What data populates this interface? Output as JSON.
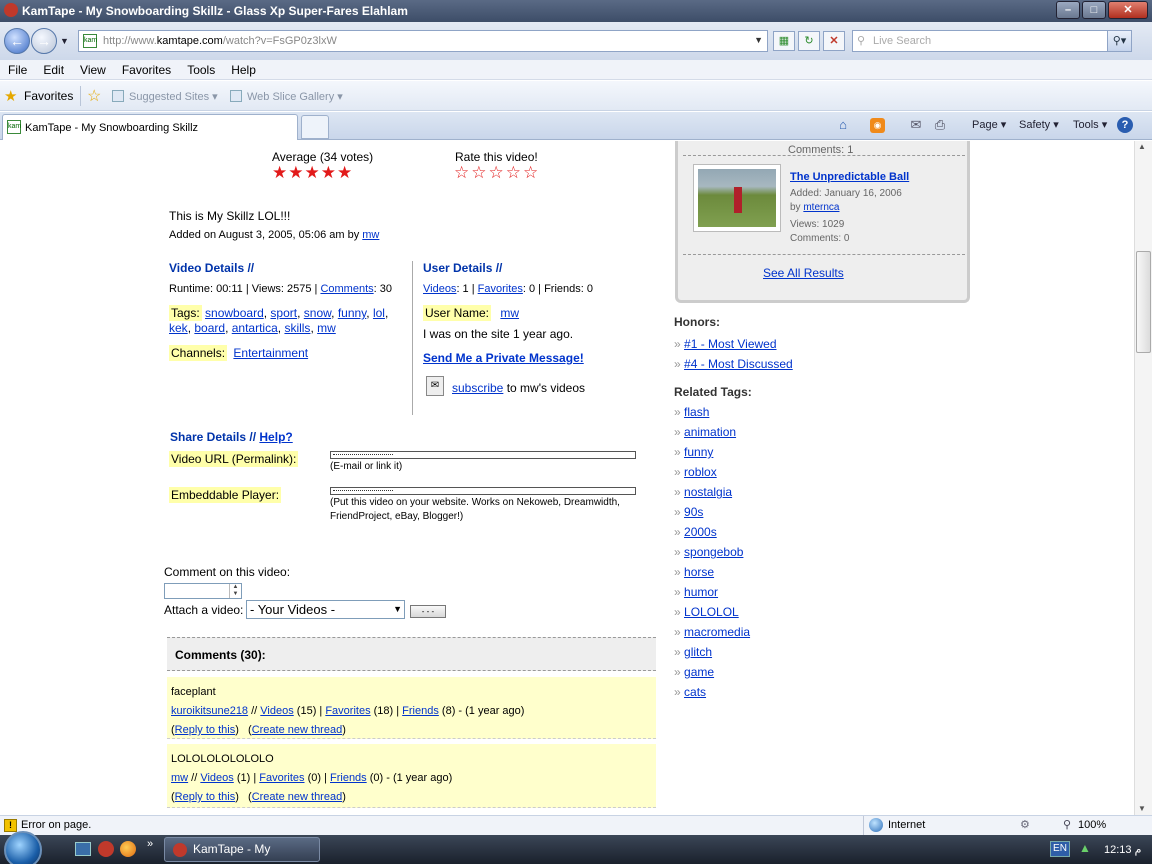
{
  "window": {
    "title": "KamTape - My Snowboarding Skillz - Glass Xp Super-Fares Elahlam",
    "buttons": {
      "minimize": "–",
      "maximize": "□",
      "close": "✕"
    }
  },
  "address_bar": {
    "url_prefix": "http://www.",
    "url_domain": "kamtape.com",
    "url_suffix": "/watch?v=FsGP0z3lxW",
    "favicon_text": "kam",
    "search_placeholder": "Live Search"
  },
  "menu": [
    "File",
    "Edit",
    "View",
    "Favorites",
    "Tools",
    "Help"
  ],
  "favorites_bar": {
    "favorites_label": "Favorites",
    "suggested_sites": "Suggested Sites ▾",
    "web_slice_gallery": "Web Slice Gallery ▾"
  },
  "tab": {
    "title": "KamTape - My Snowboarding Skillz"
  },
  "command_bar": {
    "page": "Page ▾",
    "safety": "Safety ▾",
    "tools": "Tools ▾"
  },
  "rating": {
    "average_label": "Average (34 votes)",
    "average_stars": "★★★★★",
    "average_value": 4.5,
    "rate_label": "Rate this video!",
    "rate_stars": "☆☆☆☆☆"
  },
  "video": {
    "description": "This is My Skillz LOL!!!",
    "added_prefix": "Added on August 3, 2005, 05:06 am by ",
    "added_user": "mw"
  },
  "video_details": {
    "title": "Video Details",
    "sep": " //",
    "runtime_views": "Runtime: 00:11 | Views: 2575 | ",
    "comments_link": "Comments",
    "comments_count": ": 30",
    "tags_label": "Tags:",
    "tags": [
      "snowboard",
      "sport",
      "snow",
      "funny",
      "lol",
      "kek",
      "board",
      "antartica",
      "skills",
      "mw"
    ],
    "channels_label": "Channels:",
    "channel": "Entertainment"
  },
  "user_details": {
    "title": "User Details",
    "sep": " //",
    "videos_link": "Videos",
    "videos_count": ": 1 | ",
    "favorites_link": "Favorites",
    "favorites_count": ": 0 | Friends: 0",
    "username_label": "User Name:",
    "username": "mw",
    "joined": "I was on the site 1 year ago.",
    "private_message": "Send Me a Private Message!",
    "subscribe_link": "subscribe",
    "subscribe_suffix": " to mw's videos"
  },
  "share": {
    "title": "Share Details",
    "sep": " // ",
    "help": "Help?",
    "url_label": "Video URL (Permalink):",
    "url_hint": "(E-mail or link it)",
    "embed_label": "Embeddable Player:",
    "embed_hint_1": "(Put this video on your website. Works on Nekoweb, Dreamwidth,",
    "embed_hint_2": "FriendProject, eBay, Blogger!)"
  },
  "comment_form": {
    "title": "Comment on this video:",
    "attach_label": "Attach a video:",
    "select_value": "- Your Videos -",
    "button_label": "- - -"
  },
  "comments": {
    "header": "Comments (30):",
    "items": [
      {
        "text": "faceplant",
        "user": "kuroikitsune218",
        "videos": "Videos",
        "videos_count": " (15) | ",
        "favorites": "Favorites",
        "favorites_count": " (18) | ",
        "friends": "Friends",
        "friends_count": " (8) - (1 year ago)",
        "reply": "Reply to this",
        "new_thread": "Create new thread"
      },
      {
        "text": "LOLOLOLOLOLOLO",
        "user": "mw",
        "videos": "Videos",
        "videos_count": " (1) | ",
        "favorites": "Favorites",
        "favorites_count": " (0) | ",
        "friends": "Friends",
        "friends_count": " (0) - (1 year ago)",
        "reply": "Reply to this",
        "new_thread": "Create new thread"
      }
    ]
  },
  "results_panel": {
    "prev_comments": "Comments: 1",
    "item": {
      "title": "The Unpredictable Ball",
      "added": "Added: January 16, 2006",
      "by_prefix": "by ",
      "by_user": "mternca",
      "views": "Views: 1029",
      "comments": "Comments: 0"
    },
    "see_all": "See All Results"
  },
  "honors": {
    "title": "Honors:",
    "items": [
      "#1 - Most Viewed",
      "#4 - Most Discussed"
    ]
  },
  "related_tags": {
    "title": "Related Tags:",
    "items": [
      "flash",
      "animation",
      "funny",
      "roblox",
      "nostalgia",
      "90s",
      "2000s",
      "spongebob",
      "horse",
      "humor",
      "LOLOLOL",
      "macromedia",
      "glitch",
      "game",
      "cats"
    ]
  },
  "status_bar": {
    "error_text": "Error on page.",
    "zone": "Internet",
    "zoom": "100%"
  },
  "taskbar": {
    "task_title": "KamTape - My Snowb...",
    "lang": "EN",
    "time": "12:13 م"
  }
}
